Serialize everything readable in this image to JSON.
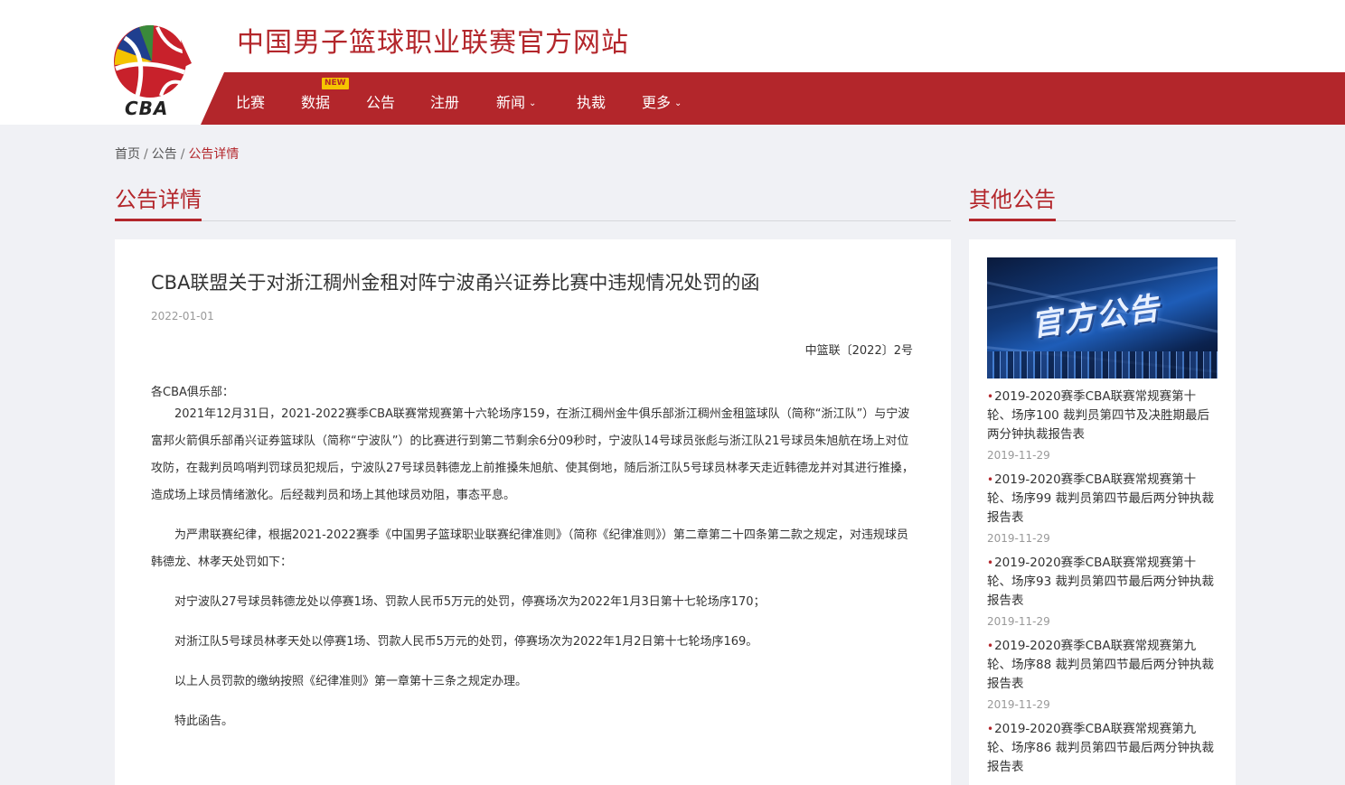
{
  "header": {
    "site_title": "中国男子篮球职业联赛官方网站",
    "logo_text": "CBA",
    "brand_color": "#b3262b",
    "nav": [
      {
        "label": "比赛",
        "dropdown": false
      },
      {
        "label": "数据",
        "dropdown": false,
        "badge": "NEW"
      },
      {
        "label": "公告",
        "dropdown": false
      },
      {
        "label": "注册",
        "dropdown": false
      },
      {
        "label": "新闻",
        "dropdown": true
      },
      {
        "label": "执裁",
        "dropdown": false
      },
      {
        "label": "更多",
        "dropdown": true
      }
    ]
  },
  "breadcrumb": {
    "home": "首页",
    "section": "公告",
    "current": "公告详情",
    "separator": "/"
  },
  "main": {
    "section_title": "公告详情",
    "article": {
      "title": "CBA联盟关于对浙江稠州金租对阵宁波甬兴证券比赛中违规情况处罚的函",
      "date": "2022-01-01",
      "doc_number": "中篮联〔2022〕2号",
      "addressee": "各CBA俱乐部：",
      "paragraphs": [
        "2021年12月31日，2021-2022赛季CBA联赛常规赛第十六轮场序159，在浙江稠州金牛俱乐部浙江稠州金租篮球队（简称“浙江队”）与宁波富邦火箭俱乐部甬兴证券篮球队（简称“宁波队”）的比赛进行到第二节剩余6分09秒时，宁波队14号球员张彪与浙江队21号球员朱旭航在场上对位攻防，在裁判员鸣哨判罚球员犯规后，宁波队27号球员韩德龙上前推搡朱旭航、使其倒地，随后浙江队5号球员林孝天走近韩德龙并对其进行推搡，造成场上球员情绪激化。后经裁判员和场上其他球员劝阻，事态平息。",
        "为严肃联赛纪律，根据2021-2022赛季《中国男子篮球职业联赛纪律准则》（简称《纪律准则》）第二章第二十四条第二款之规定，对违规球员韩德龙、林孝天处罚如下：",
        "对宁波队27号球员韩德龙处以停赛1场、罚款人民币5万元的处罚，停赛场次为2022年1月3日第十七轮场序170；",
        "对浙江队5号球员林孝天处以停赛1场、罚款人民币5万元的处罚，停赛场次为2022年1月2日第十七轮场序169。",
        "以上人员罚款的缴纳按照《纪律准则》第一章第十三条之规定办理。",
        "特此函告。"
      ]
    }
  },
  "sidebar": {
    "section_title": "其他公告",
    "banner_text": "官方公告",
    "bullet": "•",
    "items": [
      {
        "title": "2019-2020赛季CBA联赛常规赛第十轮、场序100 裁判员第四节及决胜期最后两分钟执裁报告表",
        "date": "2019-11-29"
      },
      {
        "title": "2019-2020赛季CBA联赛常规赛第十轮、场序99 裁判员第四节最后两分钟执裁报告表",
        "date": "2019-11-29"
      },
      {
        "title": "2019-2020赛季CBA联赛常规赛第十轮、场序93 裁判员第四节最后两分钟执裁报告表",
        "date": "2019-11-29"
      },
      {
        "title": "2019-2020赛季CBA联赛常规赛第九轮、场序88 裁判员第四节最后两分钟执裁报告表",
        "date": "2019-11-29"
      },
      {
        "title": "2019-2020赛季CBA联赛常规赛第九轮、场序86 裁判员第四节最后两分钟执裁报告表",
        "date": ""
      }
    ]
  }
}
